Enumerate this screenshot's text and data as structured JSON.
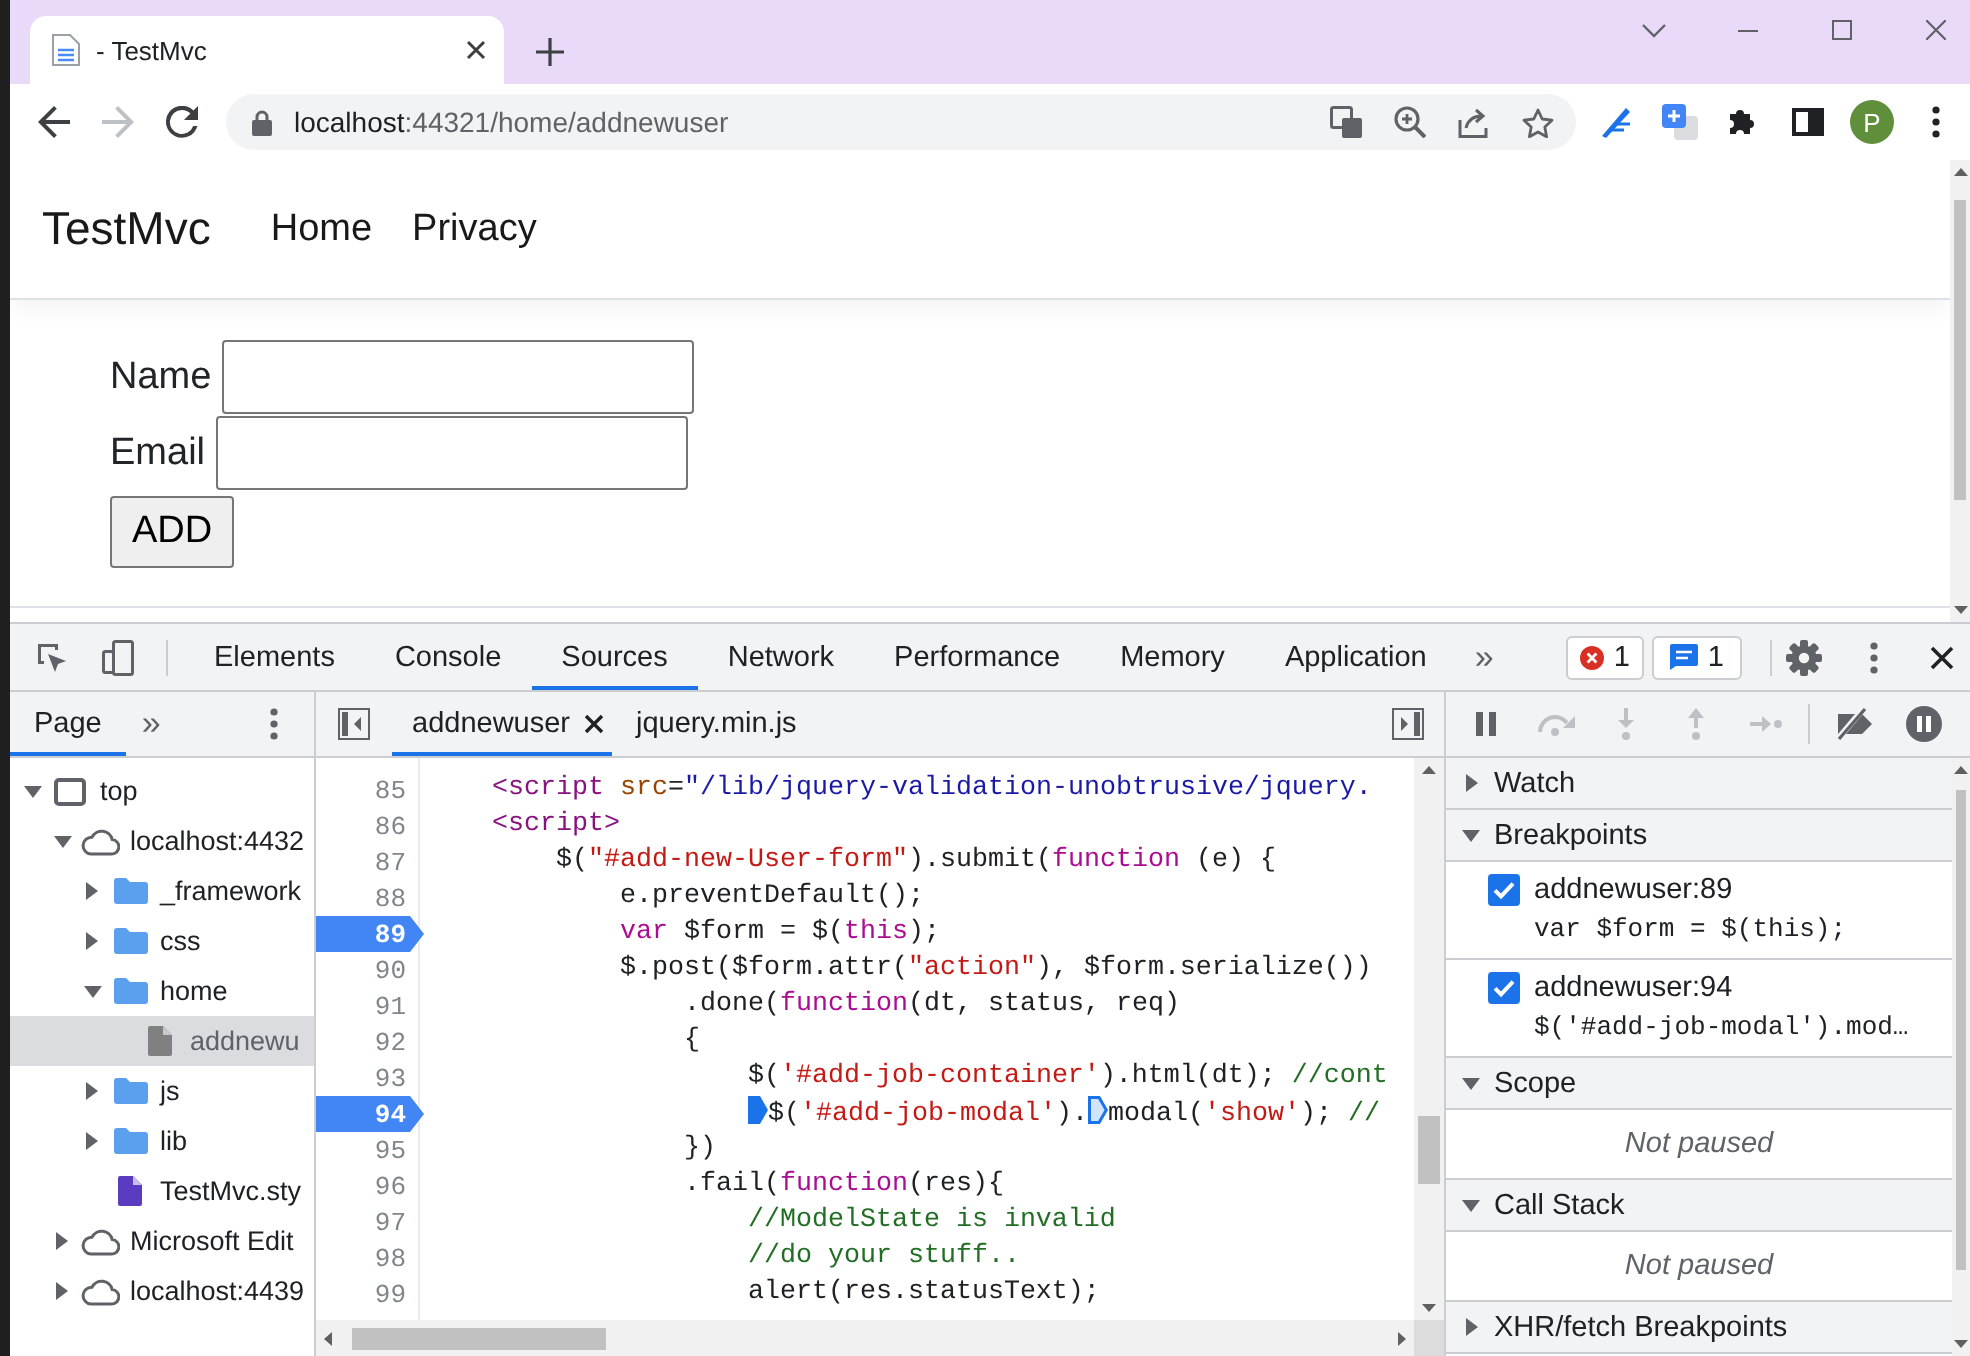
{
  "browser": {
    "tab": {
      "title": "- TestMvc",
      "selected": true
    },
    "nav_buttons": [
      {
        "kind": "back",
        "disabled": false
      },
      {
        "kind": "forward",
        "disabled": true
      },
      {
        "kind": "reload",
        "disabled": false
      }
    ],
    "address_bar": {
      "host": "localhost",
      "path": ":44321/home/addnewuser"
    },
    "profile": {
      "initial": "P"
    }
  },
  "page": {
    "brand": "TestMvc",
    "nav": [
      "Home",
      "Privacy"
    ],
    "form": {
      "fields": [
        {
          "label": "Name"
        },
        {
          "label": "Email"
        }
      ],
      "submit": "ADD"
    }
  },
  "devtools": {
    "tabs": [
      {
        "label": "Elements",
        "selected": false
      },
      {
        "label": "Console",
        "selected": false
      },
      {
        "label": "Sources",
        "selected": true
      },
      {
        "label": "Network",
        "selected": false
      },
      {
        "label": "Performance",
        "selected": false
      },
      {
        "label": "Memory",
        "selected": false
      },
      {
        "label": "Application",
        "selected": false
      }
    ],
    "more_tabs": "»",
    "errors": "1",
    "messages": "1",
    "navigator": {
      "tabs": [
        {
          "label": "Page",
          "selected": true
        }
      ],
      "more_tabs": "»",
      "tree": [
        {
          "label": "top",
          "kind": "frame",
          "expanded": true,
          "selected": false,
          "children": [
            {
              "label": "localhost:4432",
              "kind": "origin",
              "expanded": true,
              "selected": false,
              "children": [
                {
                  "label": "_framework",
                  "kind": "folder",
                  "expanded": false,
                  "selected": false
                },
                {
                  "label": "css",
                  "kind": "folder",
                  "expanded": false,
                  "selected": false
                },
                {
                  "label": "home",
                  "kind": "folder",
                  "expanded": true,
                  "selected": false,
                  "children": [
                    {
                      "label": "addnewu",
                      "kind": "document",
                      "selected": true
                    }
                  ]
                },
                {
                  "label": "js",
                  "kind": "folder",
                  "expanded": false,
                  "selected": false
                },
                {
                  "label": "lib",
                  "kind": "folder",
                  "expanded": false,
                  "selected": false
                },
                {
                  "label": "TestMvc.sty",
                  "kind": "stylesheet",
                  "selected": false
                }
              ]
            },
            {
              "label": "Microsoft Edit",
              "kind": "origin",
              "expanded": false,
              "selected": false
            },
            {
              "label": "localhost:4439",
              "kind": "origin",
              "expanded": false,
              "selected": false
            }
          ]
        }
      ]
    },
    "editor": {
      "tabs": [
        {
          "label": "addnewuser",
          "selected": true
        },
        {
          "label": "jquery.min.js",
          "selected": false
        }
      ],
      "lines": [
        {
          "number": "85",
          "breakpoint": false,
          "tokens": [
            {
              "kind": "tag",
              "text": "    <script"
            },
            {
              "kind": "attr",
              "text": " src"
            },
            {
              "kind": "plain",
              "text": "="
            },
            {
              "kind": "value",
              "text": "\"/lib/jquery-validation-unobtrusive/jquery."
            }
          ]
        },
        {
          "number": "86",
          "breakpoint": false,
          "tokens": [
            {
              "kind": "tag",
              "text": "    <script>"
            }
          ]
        },
        {
          "number": "87",
          "breakpoint": false,
          "tokens": [
            {
              "kind": "plain",
              "text": "        $("
            },
            {
              "kind": "string",
              "text": "\"#add-new-User-form\""
            },
            {
              "kind": "plain",
              "text": ").submit("
            },
            {
              "kind": "keyword",
              "text": "function"
            },
            {
              "kind": "plain",
              "text": " (e) {"
            }
          ]
        },
        {
          "number": "88",
          "breakpoint": false,
          "tokens": [
            {
              "kind": "plain",
              "text": "            e.preventDefault();"
            }
          ]
        },
        {
          "number": "89",
          "breakpoint": true,
          "tokens": [
            {
              "kind": "keyword",
              "text": "            var"
            },
            {
              "kind": "plain",
              "text": " $form = $("
            },
            {
              "kind": "keyword",
              "text": "this"
            },
            {
              "kind": "plain",
              "text": ");"
            }
          ]
        },
        {
          "number": "90",
          "breakpoint": false,
          "tokens": [
            {
              "kind": "plain",
              "text": "            $.post($form.attr("
            },
            {
              "kind": "string",
              "text": "\"action\""
            },
            {
              "kind": "plain",
              "text": "), $form.serialize())"
            }
          ]
        },
        {
          "number": "91",
          "breakpoint": false,
          "tokens": [
            {
              "kind": "plain",
              "text": "                .done("
            },
            {
              "kind": "keyword",
              "text": "function"
            },
            {
              "kind": "plain",
              "text": "(dt, status, req)"
            }
          ]
        },
        {
          "number": "92",
          "breakpoint": false,
          "tokens": [
            {
              "kind": "plain",
              "text": "                {"
            }
          ]
        },
        {
          "number": "93",
          "breakpoint": false,
          "tokens": [
            {
              "kind": "plain",
              "text": "                    $("
            },
            {
              "kind": "string",
              "text": "'#add-job-container'"
            },
            {
              "kind": "plain",
              "text": ").html(dt); "
            },
            {
              "kind": "comment",
              "text": "//cont"
            }
          ]
        },
        {
          "number": "94",
          "breakpoint": true,
          "tokens": [
            {
              "kind": "plain",
              "text": "                    $(",
              "inline_breakpoint": {
                "active": true
              }
            },
            {
              "kind": "string",
              "text": "'#add-job-modal'"
            },
            {
              "kind": "plain",
              "text": ")."
            },
            {
              "kind": "plain",
              "text": "modal(",
              "inline_breakpoint": {
                "active": false
              }
            },
            {
              "kind": "string",
              "text": "'show'"
            },
            {
              "kind": "plain",
              "text": "); "
            },
            {
              "kind": "comment",
              "text": "//"
            }
          ]
        },
        {
          "number": "95",
          "breakpoint": false,
          "tokens": [
            {
              "kind": "plain",
              "text": "                })"
            }
          ]
        },
        {
          "number": "96",
          "breakpoint": false,
          "tokens": [
            {
              "kind": "plain",
              "text": "                .fail("
            },
            {
              "kind": "keyword",
              "text": "function"
            },
            {
              "kind": "plain",
              "text": "(res){"
            }
          ]
        },
        {
          "number": "97",
          "breakpoint": false,
          "tokens": [
            {
              "kind": "comment",
              "text": "                    //ModelState is invalid"
            }
          ]
        },
        {
          "number": "98",
          "breakpoint": false,
          "tokens": [
            {
              "kind": "comment",
              "text": "                    //do your stuff.."
            }
          ]
        },
        {
          "number": "99",
          "breakpoint": false,
          "tokens": [
            {
              "kind": "plain",
              "text": "                    alert(res.statusText);"
            }
          ]
        }
      ]
    },
    "debugger": {
      "controls": [
        {
          "kind": "pause",
          "disabled": false
        },
        {
          "kind": "step_over",
          "disabled": true
        },
        {
          "kind": "step_into",
          "disabled": true
        },
        {
          "kind": "step_out",
          "disabled": true
        },
        {
          "kind": "step",
          "disabled": true
        },
        {
          "kind": "deactivate_breakpoints",
          "disabled": false
        },
        {
          "kind": "pause_on_exceptions",
          "disabled": false
        }
      ],
      "sections": [
        {
          "title": "Watch",
          "expanded": false
        },
        {
          "title": "Breakpoints",
          "expanded": true,
          "items": [
            {
              "location": "addnewuser:89",
              "code": "var $form = $(this);",
              "checked": true
            },
            {
              "location": "addnewuser:94",
              "code": "$('#add-job-modal').mod…",
              "checked": true
            }
          ]
        },
        {
          "title": "Scope",
          "expanded": true,
          "message": "Not paused"
        },
        {
          "title": "Call Stack",
          "expanded": true,
          "message": "Not paused"
        },
        {
          "title": "XHR/fetch Breakpoints",
          "expanded": false
        }
      ]
    }
  }
}
